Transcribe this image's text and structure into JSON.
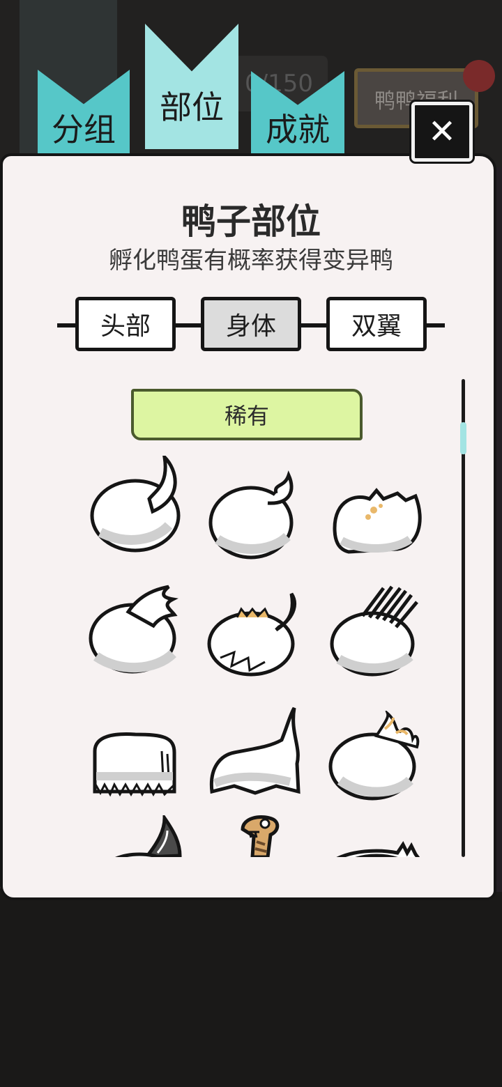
{
  "header": {
    "tabs": [
      {
        "label": "分组"
      },
      {
        "label": "部位"
      },
      {
        "label": "成就"
      }
    ],
    "counter_text": "0/150",
    "welfare_label": "鸭鸭福利",
    "close_glyph": "✕"
  },
  "panel": {
    "title": "鸭子部位",
    "subtitle": "孵化鸭蛋有概率获得变异鸭",
    "segments": [
      {
        "label": "头部"
      },
      {
        "label": "身体"
      },
      {
        "label": "双翼"
      }
    ],
    "rarity_label": "稀有"
  },
  "colors": {
    "tab_active": "#a3e4e3",
    "tab_inactive": "#56c7c8",
    "rarity_ribbon": "#ddf5a2",
    "page": "#f7f2f2"
  },
  "items": [
    {
      "icon": "body-tail-curl-icon"
    },
    {
      "icon": "body-flame-tail-icon"
    },
    {
      "icon": "body-spotted-icon"
    },
    {
      "icon": "body-winged-icon"
    },
    {
      "icon": "body-spiked-icon"
    },
    {
      "icon": "body-quill-icon"
    },
    {
      "icon": "body-fur-icon"
    },
    {
      "icon": "body-ghost-icon"
    },
    {
      "icon": "body-fire-icon"
    },
    {
      "icon": "body-dark-horn-icon"
    },
    {
      "icon": "body-snake-icon"
    },
    {
      "icon": "body-spike-back-icon"
    }
  ]
}
